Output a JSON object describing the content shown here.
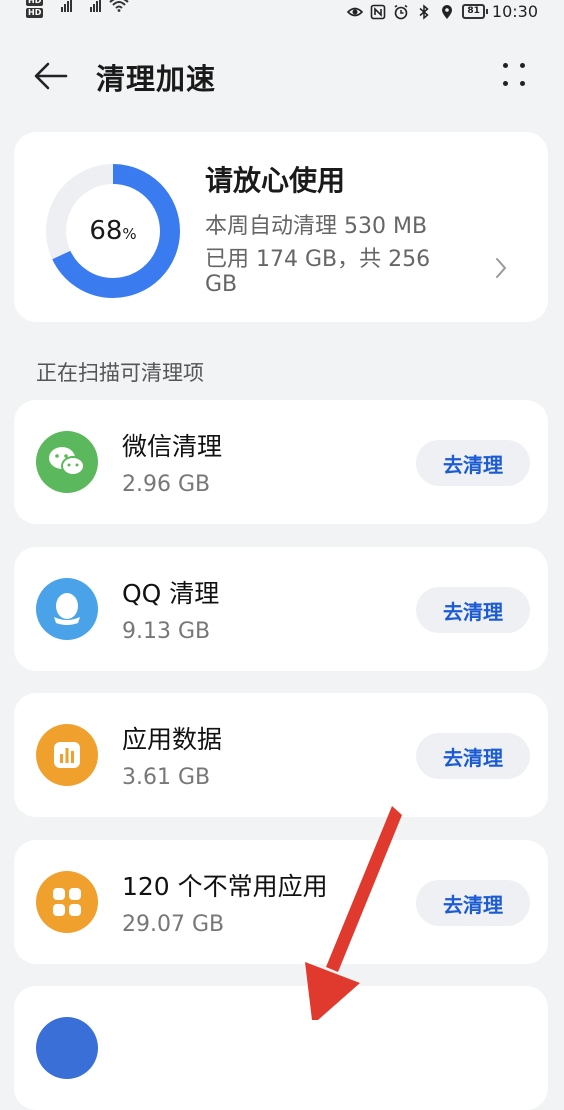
{
  "status_bar": {
    "time": "10:30",
    "battery": "81",
    "network_1": "4G",
    "network_2": "4G",
    "hd_1": "HD",
    "hd_2": "HD"
  },
  "header": {
    "title": "清理加速"
  },
  "storage": {
    "percent": "68",
    "percent_sign": "%",
    "used_fraction": 0.68,
    "title": "请放心使用",
    "weekly_cleaned": "本周自动清理 530 MB",
    "usage_line1": "已用 174 GB，共 256",
    "usage_line2": "GB",
    "accent_color": "#3a7cf0"
  },
  "section_label": "正在扫描可清理项",
  "items": [
    {
      "title": "微信清理",
      "size": "2.96 GB",
      "button": "去清理",
      "icon": "wechat-icon",
      "color": "#5cb85c"
    },
    {
      "title": "QQ 清理",
      "size": "9.13 GB",
      "button": "去清理",
      "icon": "qq-icon",
      "color": "#4aa3e8"
    },
    {
      "title": "应用数据",
      "size": "3.61 GB",
      "button": "去清理",
      "icon": "app-data-icon",
      "color": "#f0a02c"
    },
    {
      "title": "120 个不常用应用",
      "size": "29.07 GB",
      "button": "去清理",
      "icon": "unused-apps-icon",
      "color": "#f0a02c"
    }
  ],
  "partial_item": {
    "icon_color": "#3a6fd8"
  },
  "annotation": {
    "arrow_color": "#e03a2e"
  }
}
